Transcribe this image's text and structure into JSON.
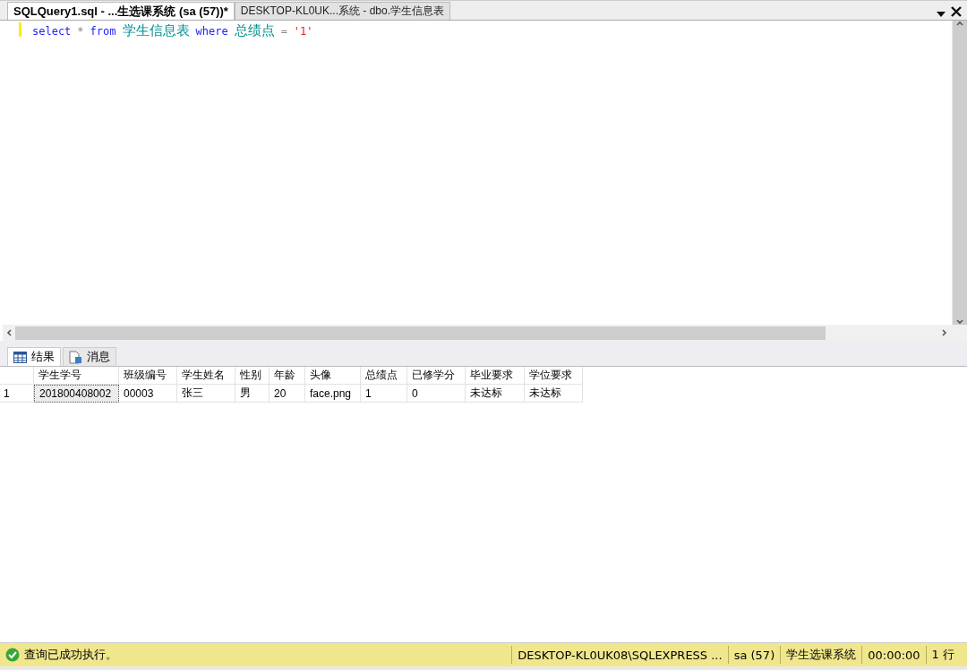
{
  "doc_tabs": [
    {
      "label": "SQLQuery1.sql - ...生选课系统 (sa (57))*",
      "selected": true
    },
    {
      "label": "DESKTOP-KL0UK...系统 - dbo.学生信息表",
      "selected": false
    }
  ],
  "editor": {
    "tokens": [
      {
        "kind": "keyword",
        "text": "select"
      },
      {
        "kind": "operator",
        "text": "*"
      },
      {
        "kind": "keyword",
        "text": "from"
      },
      {
        "kind": "identifier",
        "text": "学生信息表"
      },
      {
        "kind": "keyword",
        "text": "where"
      },
      {
        "kind": "identifier",
        "text": "总绩点"
      },
      {
        "kind": "operator",
        "text": "="
      },
      {
        "kind": "string",
        "text": "'1'"
      }
    ]
  },
  "result_tabs": [
    {
      "label": "结果",
      "selected": true,
      "kind": "grid"
    },
    {
      "label": "消息",
      "selected": false,
      "kind": "messages"
    }
  ],
  "grid": {
    "columns": [
      "学生学号",
      "班级编号",
      "学生姓名",
      "性别",
      "年龄",
      "头像",
      "总绩点",
      "已修学分",
      "毕业要求",
      "学位要求"
    ],
    "rows": [
      {
        "number": "1",
        "cells": [
          {
            "text": "201800408002",
            "selected": true
          },
          {
            "text": "00003",
            "selected": false
          },
          {
            "text": "张三",
            "selected": false
          },
          {
            "text": "男",
            "selected": false
          },
          {
            "text": "20",
            "selected": false
          },
          {
            "text": "face.png",
            "selected": false
          },
          {
            "text": "1",
            "selected": false
          },
          {
            "text": "0",
            "selected": false
          },
          {
            "text": "未达标",
            "selected": false
          },
          {
            "text": "未达标",
            "selected": false
          }
        ]
      }
    ]
  },
  "status_bar": {
    "message": "查询已成功执行。",
    "server": "DESKTOP-KL0UK08\\SQLEXPRESS ...",
    "user": "sa (57)",
    "database": "学生选课系统",
    "elapsed": "00:00:00",
    "rows": "1 行"
  }
}
